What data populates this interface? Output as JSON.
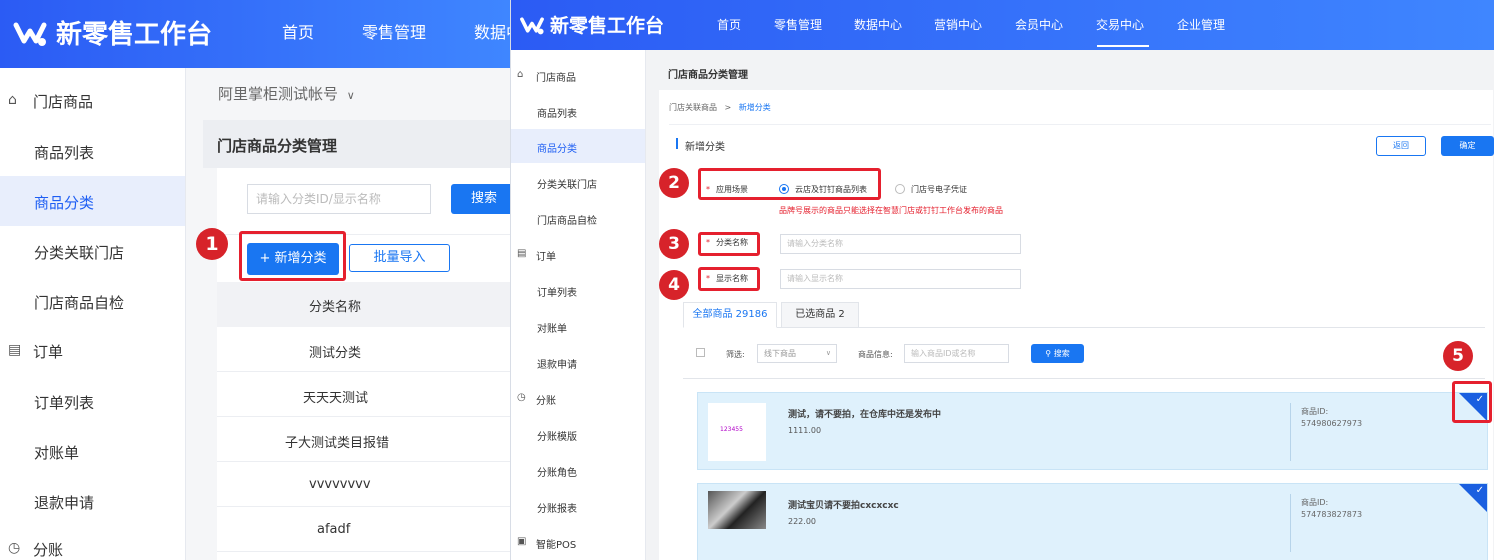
{
  "left": {
    "brand": "新零售工作台",
    "nav": [
      "首页",
      "零售管理",
      "数据中心"
    ],
    "sidebar": {
      "groups": [
        {
          "label": "门店商品",
          "icon": "store-icon"
        },
        {
          "label": "订单",
          "icon": "order-icon"
        },
        {
          "label": "分账",
          "icon": "clock-icon"
        }
      ],
      "items": [
        "商品列表",
        "商品分类",
        "分类关联门店",
        "门店商品自检",
        "订单列表",
        "对账单",
        "退款申请"
      ]
    },
    "account": "阿里掌柜测试帐号",
    "page_title": "门店商品分类管理",
    "search_placeholder": "请输入分类ID/显示名称",
    "search_button": "搜索",
    "add_button": "+ 新增分类",
    "import_button": "批量导入",
    "table_header": "分类名称",
    "rows": [
      "测试分类",
      "天天天测试",
      "子大测试类目报错",
      "vvvvvvvv",
      "afadf"
    ],
    "badge": "1"
  },
  "right": {
    "brand": "新零售工作台",
    "nav": [
      "首页",
      "零售管理",
      "数据中心",
      "营销中心",
      "会员中心",
      "交易中心",
      "企业管理"
    ],
    "active_nav": "交易中心",
    "sidebar": {
      "store_group": "门店商品",
      "store_items": [
        "商品列表",
        "商品分类",
        "分类关联门店",
        "门店商品自检"
      ],
      "order_group": "订单",
      "order_items": [
        "订单列表",
        "对账单",
        "退款申请"
      ],
      "split_group": "分账",
      "split_items": [
        "分账模版",
        "分账角色",
        "分账报表"
      ],
      "pos_group": "智能POS"
    },
    "page_title": "门店商品分类管理",
    "breadcrumb": {
      "parent": "门店关联商品",
      "sep": ">",
      "current": "新增分类"
    },
    "section_title": "新增分类",
    "back_button": "返回",
    "confirm_button": "确定",
    "scene": {
      "label": "应用场景",
      "required": "*",
      "option1": "云店及钉钉商品列表",
      "option2": "门店号电子凭证",
      "hint": "品牌号展示的商品只能选择在智慧门店或钉钉工作台发布的商品"
    },
    "category_name": {
      "label": "分类名称",
      "required": "*",
      "placeholder": "请输入分类名称"
    },
    "display_name": {
      "label": "显示名称",
      "required": "*",
      "placeholder": "请输入显示名称"
    },
    "tabs": [
      "全部商品 29186",
      "已选商品 2"
    ],
    "filter": {
      "label": "筛选:",
      "select": "线下商品",
      "info_label": "商品信息:",
      "info_placeholder": "输入商品ID或名称",
      "search": "搜索"
    },
    "products": [
      {
        "name": "测试，请不要拍，在仓库中还是发布中",
        "price": "1111.00",
        "id_label": "商品ID:",
        "id": "574980627973",
        "thumb": "123455"
      },
      {
        "name": "测试宝贝请不要拍cxcxcxc",
        "price": "222.00",
        "id_label": "商品ID:",
        "id": "574783827873"
      }
    ],
    "badges": [
      "2",
      "3",
      "4",
      "5"
    ]
  },
  "colors": {
    "primary": "#1976f2",
    "annotation": "#e5202e",
    "selected_row": "#dff1fc"
  }
}
